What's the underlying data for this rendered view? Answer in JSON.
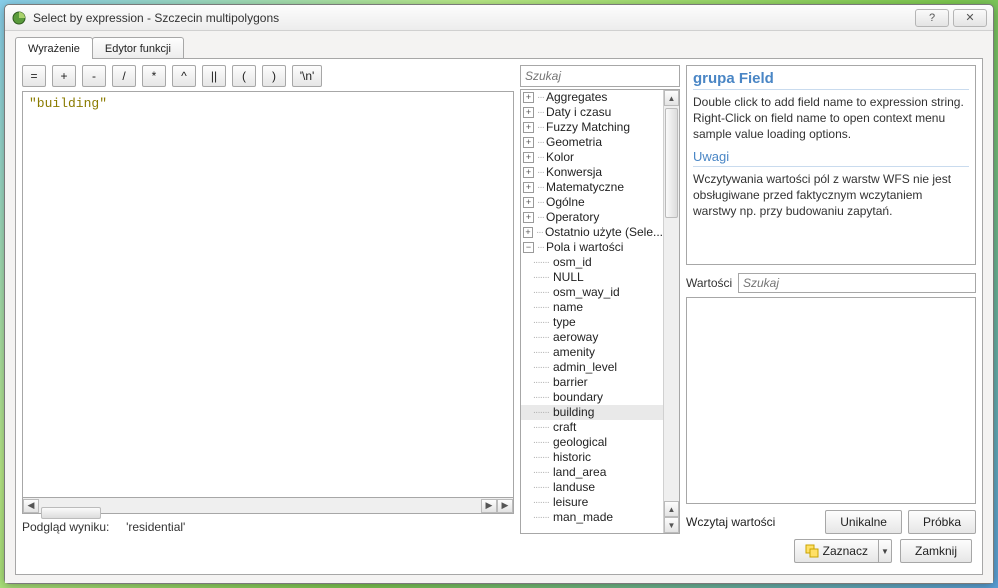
{
  "window": {
    "title": "Select by expression - Szczecin multipolygons"
  },
  "tabs": {
    "expression": "Wyrażenie",
    "function_editor": "Edytor funkcji"
  },
  "operators": {
    "eq": "=",
    "plus": "+",
    "minus": "-",
    "div": "/",
    "mul": "*",
    "pow": "^",
    "concat": "||",
    "lparen": "(",
    "rparen": ")",
    "nl": "'\\n'"
  },
  "expression": {
    "text": "\"building\""
  },
  "result": {
    "label": "Podgląd wyniku:",
    "value": "'residential'"
  },
  "search": {
    "placeholder": "Szukaj"
  },
  "tree": {
    "groups": [
      "Aggregates",
      "Daty i czasu",
      "Fuzzy Matching",
      "Geometria",
      "Kolor",
      "Konwersja",
      "Matematyczne",
      "Ogólne",
      "Operatory",
      "Ostatnio użyte (Sele..."
    ],
    "fields_group": "Pola i wartości",
    "fields": [
      "osm_id",
      "NULL",
      "osm_way_id",
      "name",
      "type",
      "aeroway",
      "amenity",
      "admin_level",
      "barrier",
      "boundary",
      "building",
      "craft",
      "geological",
      "historic",
      "land_area",
      "landuse",
      "leisure",
      "man_made"
    ],
    "selected_field": "building"
  },
  "help": {
    "group_heading": "grupa Field",
    "body": "Double click to add field name to expression string. Right-Click on field name to open context menu sample value loading options.",
    "notes_heading": "Uwagi",
    "notes_body": "Wczytywania wartości pól z warstw WFS nie jest obsługiwane przed faktycznym wczytaniem warstwy np. przy budowaniu zapytań."
  },
  "values": {
    "label": "Wartości",
    "placeholder": "Szukaj"
  },
  "buttons": {
    "load_values": "Wczytaj wartości",
    "unique": "Unikalne",
    "sample": "Próbka",
    "select": "Zaznacz",
    "close": "Zamknij"
  }
}
